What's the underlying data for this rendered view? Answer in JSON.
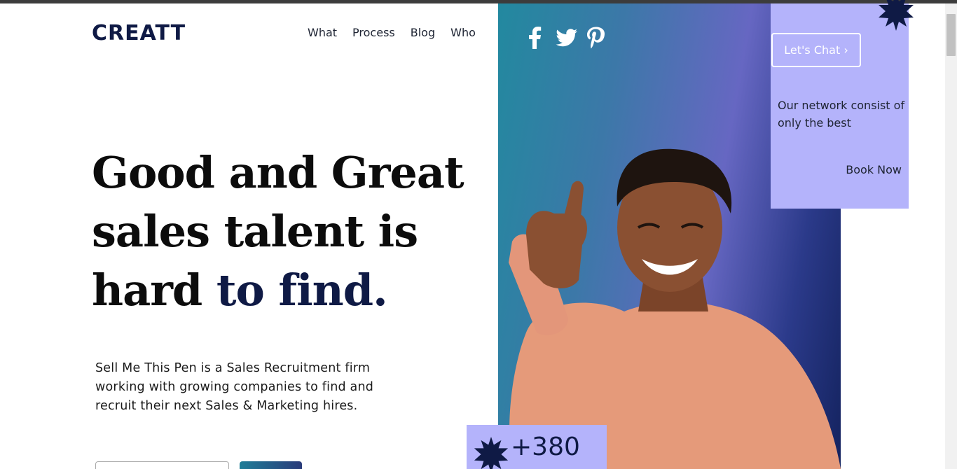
{
  "header": {
    "logo": "CREATT",
    "nav": [
      "What",
      "Process",
      "Blog",
      "Who"
    ]
  },
  "hero": {
    "title_line1": "Good and Great",
    "title_line2": "sales talent is",
    "title_line3_plain": "hard ",
    "title_line3_accent": "to find.",
    "description": "Sell Me This Pen is a Sales Recruitment firm working with growing companies to find and recruit their next Sales & Marketing hires."
  },
  "social": {
    "icons": [
      "facebook-icon",
      "twitter-icon",
      "pinterest-icon"
    ]
  },
  "side_card": {
    "chat_label": "Let's Chat",
    "chat_icon": "chevron-right-icon",
    "text": "Our network consist of only the best",
    "book_now": "Book Now"
  },
  "stat": {
    "value": "+380"
  },
  "colors": {
    "brand_dark": "#0f1a45",
    "accent_lavender": "#b4b3fb",
    "gradient_start": "#22899f",
    "gradient_end": "#14235f"
  }
}
